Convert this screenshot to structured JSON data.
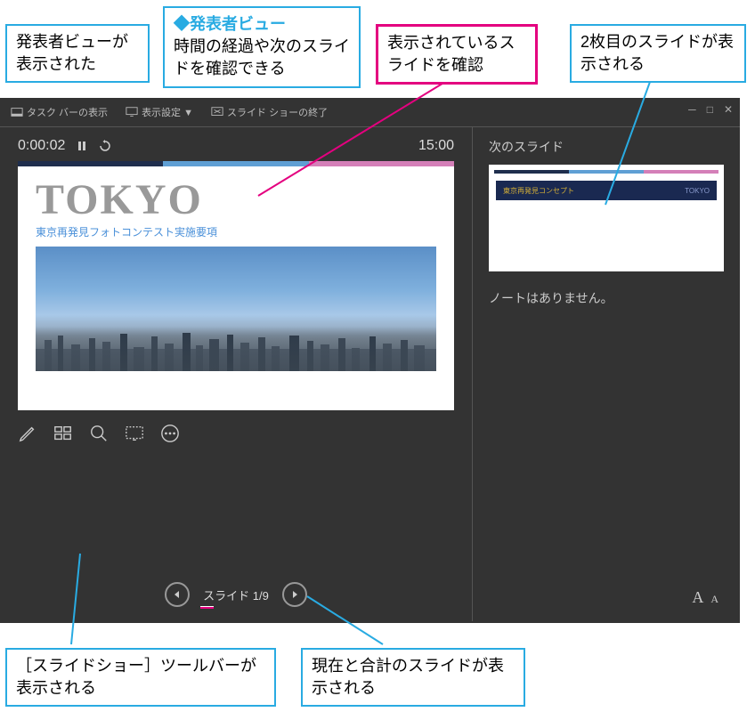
{
  "callouts": {
    "topleft": "発表者ビューが表示された",
    "topcenter_title": "◆発表者ビュー",
    "topcenter_body": "時間の経過や次のスライドを確認できる",
    "pink": "表示されているスライドを確認",
    "topright": "2枚目のスライドが表示される",
    "bottomleft": "［スライドショー］ツールバーが表示される",
    "bottomright": "現在と合計のスライドが表示される"
  },
  "toolbar": {
    "taskbar": "タスク バーの表示",
    "display_settings": "表示設定 ▼",
    "end_slideshow": "スライド ショーの終了"
  },
  "timer": {
    "elapsed": "0:00:02",
    "total": "15:00"
  },
  "slide": {
    "title": "TOKYO",
    "subtitle": "東京再発見フォトコンテスト実施要項"
  },
  "nav": {
    "counter": "スライド 1/9"
  },
  "right_panel": {
    "next_slide_label": "次のスライド",
    "next_slide_text_left": "東京再発見コンセプト",
    "next_slide_text_right": "TOKYO",
    "notes_text": "ノートはありません。"
  },
  "font_controls": {
    "large": "A",
    "small": "A"
  }
}
